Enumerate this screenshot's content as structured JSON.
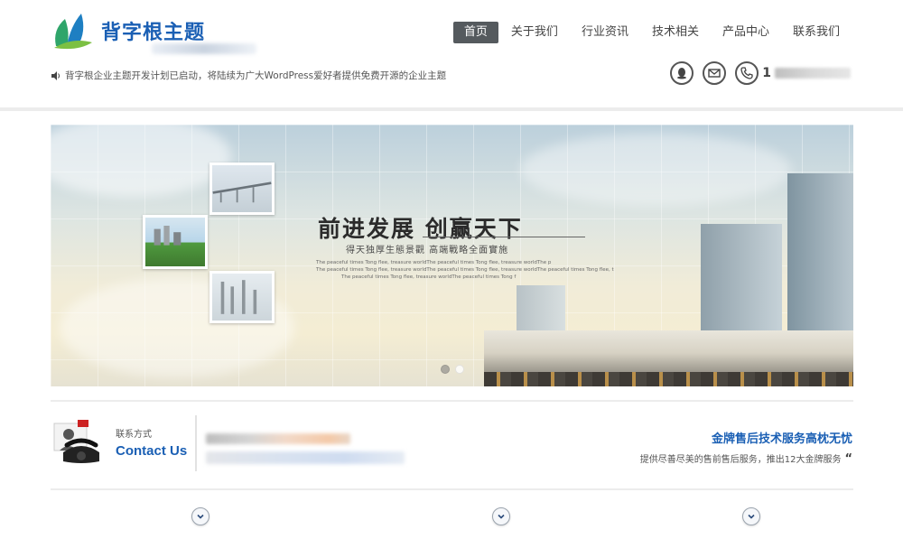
{
  "site": {
    "logo_text": "背字根主题"
  },
  "nav": {
    "items": [
      {
        "label": "首页",
        "active": true
      },
      {
        "label": "关于我们",
        "active": false
      },
      {
        "label": "行业资讯",
        "active": false
      },
      {
        "label": "技术相关",
        "active": false
      },
      {
        "label": "产品中心",
        "active": false
      },
      {
        "label": "联系我们",
        "active": false
      }
    ]
  },
  "notice": {
    "icon": "speaker-icon",
    "text": "背字根企业主题开发计划已启动，将陆续为广大WordPress爱好者提供免费开源的企业主题"
  },
  "header_contacts": {
    "icons": [
      "qq-icon",
      "mail-icon",
      "phone-icon"
    ],
    "phone_prefix": "1"
  },
  "banner": {
    "title": "前进发展  创赢天下",
    "subtitle": "得天独厚生態景觀  高端戰略全面實施",
    "small_lines": [
      "The peaceful times Tong flee, treasure worldThe peaceful times Tong flee, treasure worldThe p",
      "The peaceful times Tong flee, treasure worldThe peaceful times Tong flee, treasure worldThe peaceful times Tong flee, t",
      "The peaceful times Tong flee, treasure worldThe peaceful times Tong f"
    ],
    "slides": 2,
    "active_slide": 0
  },
  "contact": {
    "label_cn": "联系方式",
    "label_en": "Contact Us"
  },
  "service": {
    "title": "金牌售后技术服务高枕无忧",
    "desc": "提供尽善尽美的售前售后服务，推出12大金牌服务",
    "quote": "“"
  },
  "colors": {
    "brand_blue": "#1a5fb4",
    "nav_active_bg": "#555a5e"
  }
}
